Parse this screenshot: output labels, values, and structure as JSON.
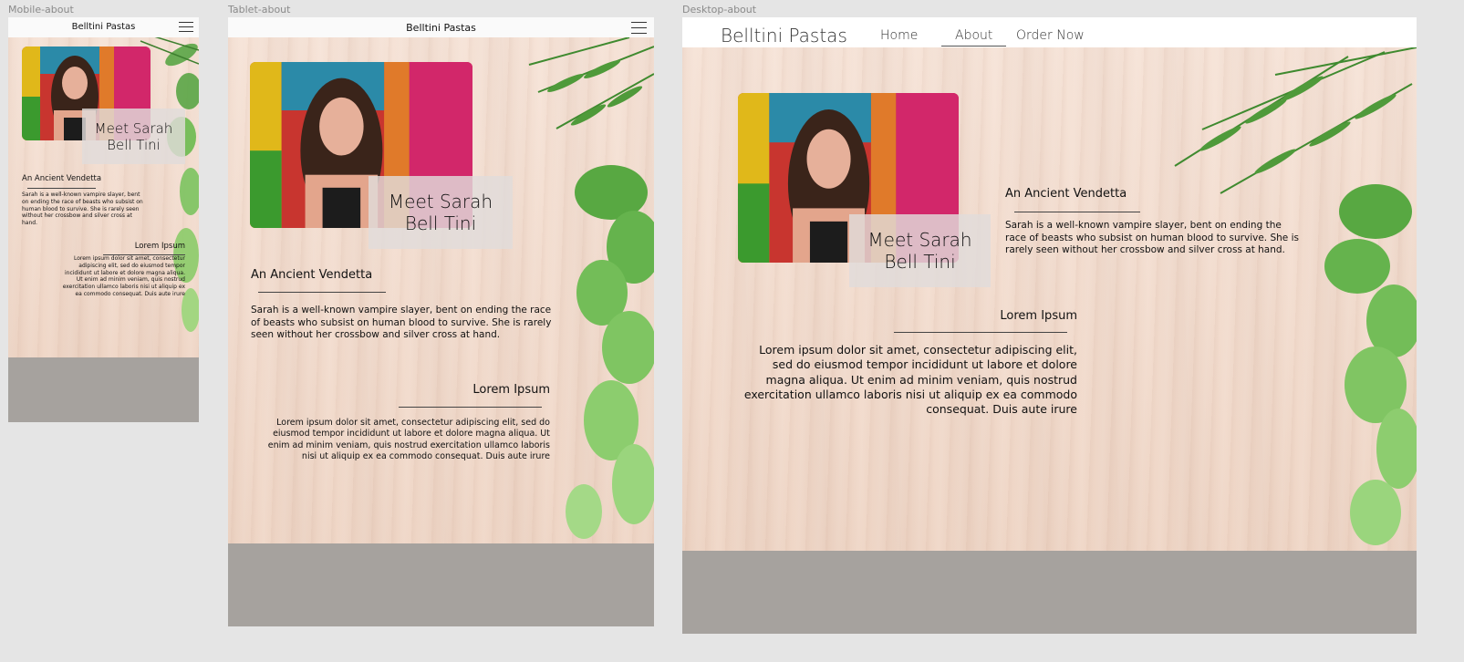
{
  "frames": {
    "mobile": {
      "label": "Mobile-about"
    },
    "tablet": {
      "label": "Tablet-about"
    },
    "desktop": {
      "label": "Desktop-about"
    }
  },
  "brand": "Belltini Pastas",
  "nav": {
    "home": "Home",
    "about": "About",
    "order": "Order Now"
  },
  "caption": {
    "line1": "Meet Sarah",
    "line2": "Bell Tini"
  },
  "section1": {
    "title": "An Ancient Vendetta",
    "body": "Sarah is a well-known vampire slayer, bent on ending the race of beasts who subsist on human blood to survive. She is rarely seen without her crossbow and silver cross at hand."
  },
  "section2": {
    "title": "Lorem Ipsum",
    "body": "Lorem ipsum dolor sit amet, consectetur adipiscing elit, sed do eiusmod tempor incididunt ut labore et dolore magna aliqua. Ut enim ad minim veniam, quis nostrud exercitation ullamco laboris nisi ut aliquip ex ea commodo consequat. Duis aute irure"
  },
  "colors": {
    "canvas": "#e5e5e5",
    "footer": "#a6a29e",
    "wood": "#f3dccf",
    "leaf": "#4f9a3a",
    "caption_bg": "#e1dcda"
  },
  "icons": [
    "hamburger-menu-icon"
  ]
}
